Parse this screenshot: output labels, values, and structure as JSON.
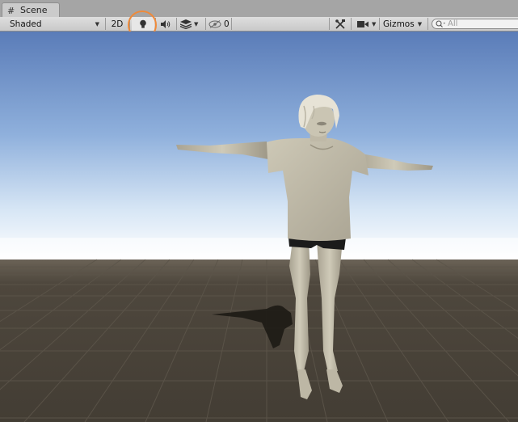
{
  "window": {
    "tab_label": "Scene",
    "tab_icon": "grid-icon"
  },
  "toolbar": {
    "draw_mode": "Shaded",
    "mode_2d": "2D",
    "lighting_toggle": {
      "icon": "light-bulb-icon",
      "active": true
    },
    "audio_toggle": {
      "icon": "speaker-icon"
    },
    "effects": {
      "icon": "layers-icon"
    },
    "hidden_objects": {
      "icon": "eye-slash-icon",
      "count": "0"
    },
    "tools_icon": "tools-icon",
    "camera": {
      "icon": "camera-icon"
    },
    "gizmos_label": "Gizmos",
    "search": {
      "placeholder": "All",
      "value": ""
    }
  },
  "annotation": {
    "color": "#ef8a3a",
    "target": "lighting_toggle"
  },
  "viewport": {
    "sky_top_color": "#5d7fb9",
    "horizon_color": "#ffffff",
    "ground_color": "#4a4339",
    "model_color": "#c5c0ae"
  }
}
